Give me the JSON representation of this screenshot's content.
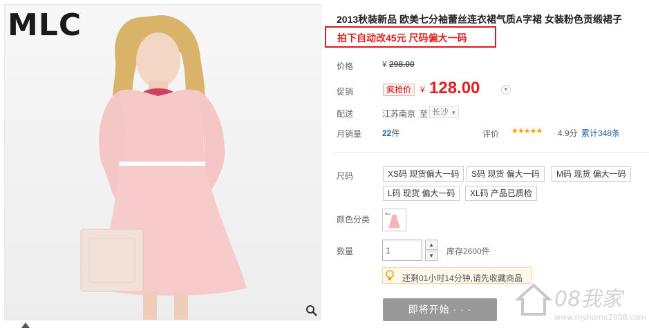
{
  "image": {
    "brand_logo": "MLC",
    "zoom_icon": "magnifier-icon"
  },
  "product": {
    "title": "2013秋装新品 欧美七分袖蕾丝连衣裙气质A字裙 女装粉色贡缎裙子",
    "promo": "拍下自动改45元 尺码偏大一码"
  },
  "labels": {
    "price": "价格",
    "promo_price": "促销",
    "shipping": "配送",
    "monthly_sales": "月销量",
    "rating": "评价",
    "size": "尺码",
    "color": "颜色分类",
    "quantity": "数量"
  },
  "price": {
    "currency": "¥",
    "original": "298.00",
    "tag": "疯抢价",
    "current": "128.00"
  },
  "shipping": {
    "origin": "江苏南京",
    "to": "至",
    "destination": "长沙"
  },
  "sales": {
    "count": "22",
    "unit": "件",
    "stars": "★★★★★",
    "score": "4.9分",
    "reviews": "累计348条"
  },
  "sizes": [
    "XS码 现货偏大一码",
    "S码 现货 偏大一码",
    "M码 现货 偏大一码",
    "L码 现货 偏大一码",
    "XL码 产品已质检"
  ],
  "color_swatch_label": "MLC",
  "quantity": {
    "value": "1",
    "stock": "库存2600件"
  },
  "tip": "还剩01小时14分钟,请先收藏商品",
  "buy_button": "即将开始 · · ·",
  "watermark": {
    "site": "08我家",
    "url": "www.myhome2008.com"
  },
  "colors": {
    "accent_red": "#e01e1e",
    "link_blue": "#225da8",
    "star_orange": "#f1a100",
    "button_gray": "#999999"
  }
}
